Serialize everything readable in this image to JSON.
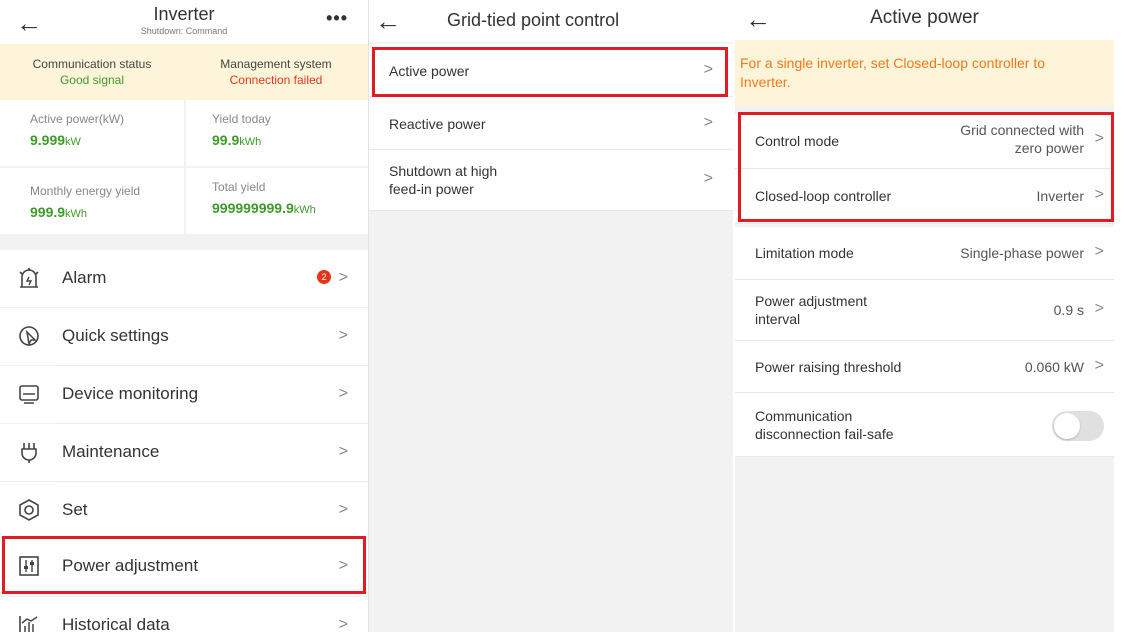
{
  "panel1": {
    "title": "Inverter",
    "subtitle": "Shutdown: Command",
    "back_icon": "←",
    "more_icon": "•••",
    "status": {
      "comm_label": "Communication status",
      "comm_value": "Good signal",
      "mgmt_label": "Management system",
      "mgmt_value": "Connection failed"
    },
    "kpis": {
      "active_power_label": "Active power(kW)",
      "active_power_value": "9.999",
      "active_power_unit": "kW",
      "yield_today_label": "Yield today",
      "yield_today_value": "99.9",
      "yield_today_unit": "kWh",
      "monthly_label": "Monthly energy yield",
      "monthly_value": "999.9",
      "monthly_unit": "kWh",
      "total_label": "Total yield",
      "total_value": "999999999.9",
      "total_unit": "kWh"
    },
    "menu": [
      {
        "label": "Alarm",
        "badge": "2",
        "icon": "alarm-icon"
      },
      {
        "label": "Quick settings",
        "icon": "quick-settings-icon"
      },
      {
        "label": "Device monitoring",
        "icon": "monitor-icon"
      },
      {
        "label": "Maintenance",
        "icon": "maintenance-icon"
      },
      {
        "label": "Set",
        "icon": "settings-icon"
      },
      {
        "label": "Power adjustment",
        "icon": "power-adjustment-icon"
      },
      {
        "label": "Historical data",
        "icon": "historical-data-icon"
      }
    ]
  },
  "panel2": {
    "title": "Grid-tied point control",
    "back_icon": "←",
    "items": [
      {
        "label": "Active power"
      },
      {
        "label": "Reactive power"
      },
      {
        "label": "Shutdown at high",
        "label2": "feed-in power"
      }
    ]
  },
  "panel3": {
    "title": "Active power",
    "back_icon": "←",
    "notice": "For a single inverter, set Closed-loop controller to Inverter.",
    "rows": {
      "control_mode": {
        "label": "Control mode",
        "value": "Grid connected with",
        "value2": "zero power"
      },
      "closed_loop": {
        "label": "Closed-loop controller",
        "value": "Inverter"
      },
      "limitation": {
        "label": "Limitation mode",
        "value": "Single-phase power"
      },
      "interval": {
        "label": "Power adjustment",
        "label2": "interval",
        "value": "0.9 s"
      },
      "threshold": {
        "label": "Power raising threshold",
        "value": "0.060 kW"
      },
      "failsafe": {
        "label": "Communication",
        "label2": "disconnection fail-safe",
        "toggle_on": false
      }
    }
  },
  "chevron": ">",
  "colors": {
    "accent_green": "#3f9a2b",
    "error_red": "#e4381c",
    "highlight_box": "#e01b24",
    "notice_orange": "#f07a1a"
  }
}
